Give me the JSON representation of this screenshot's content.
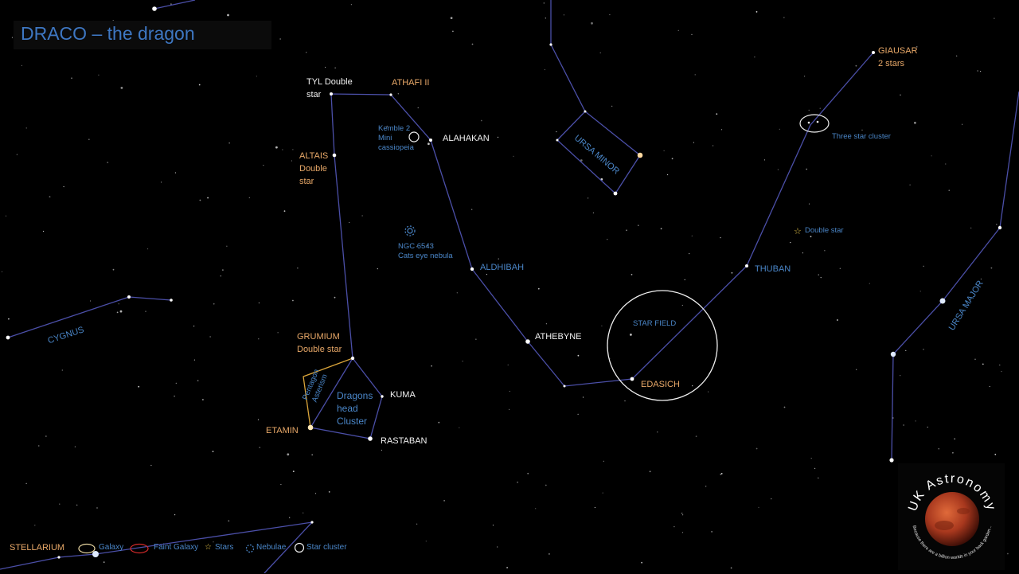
{
  "title": "DRACO – the dragon",
  "stars": {
    "tyl": "TYL  Double\nstar",
    "athafi": "ATHAFI  II",
    "alahakan": "ALAHAKAN",
    "kemble": "Kemble 2\nMini\ncassiopeia",
    "altais": "ALTAIS\nDouble\nstar",
    "ngc6543": "NGC 6543\nCats eye nebula",
    "aldhibah": "ALDHIBAH",
    "athebyne": "ATHEBYNE",
    "grumium": "GRUMIUM\nDouble star",
    "pentagon": "Pentagon\nAsterism",
    "dragons_head": "Dragons\nhead\nCluster",
    "kuma": "KUMA",
    "etamin": "ETAMIN",
    "rastaban": "RASTABAN",
    "edasich": "EDASICH",
    "star_field": "STAR FIELD",
    "thuban": "THUBAN",
    "double_star": "Double star",
    "three_star_cluster": "Three star cluster",
    "giausar": "GIAUSAR\n2 stars"
  },
  "constellations": {
    "cygnus": "CYGNUS",
    "ursa_minor": "URSA MINOR",
    "ursa_major": "URSA MAJOR"
  },
  "legend": {
    "source": "STELLARIUM",
    "galaxy": "Galaxy",
    "faint_galaxy": "Faint Galaxy",
    "stars": "Stars",
    "nebulae": "Nebulae",
    "star_cluster": "Star cluster"
  },
  "logo": {
    "name": "UK Astronomy",
    "tagline": "Because there are a billion worlds in your back garden..."
  },
  "colors": {
    "line": "#4b4fa8",
    "pentagon": "#d9a43a",
    "label_blue": "#4a86c8",
    "label_orange": "#e8a868",
    "title": "#3e77c2"
  }
}
